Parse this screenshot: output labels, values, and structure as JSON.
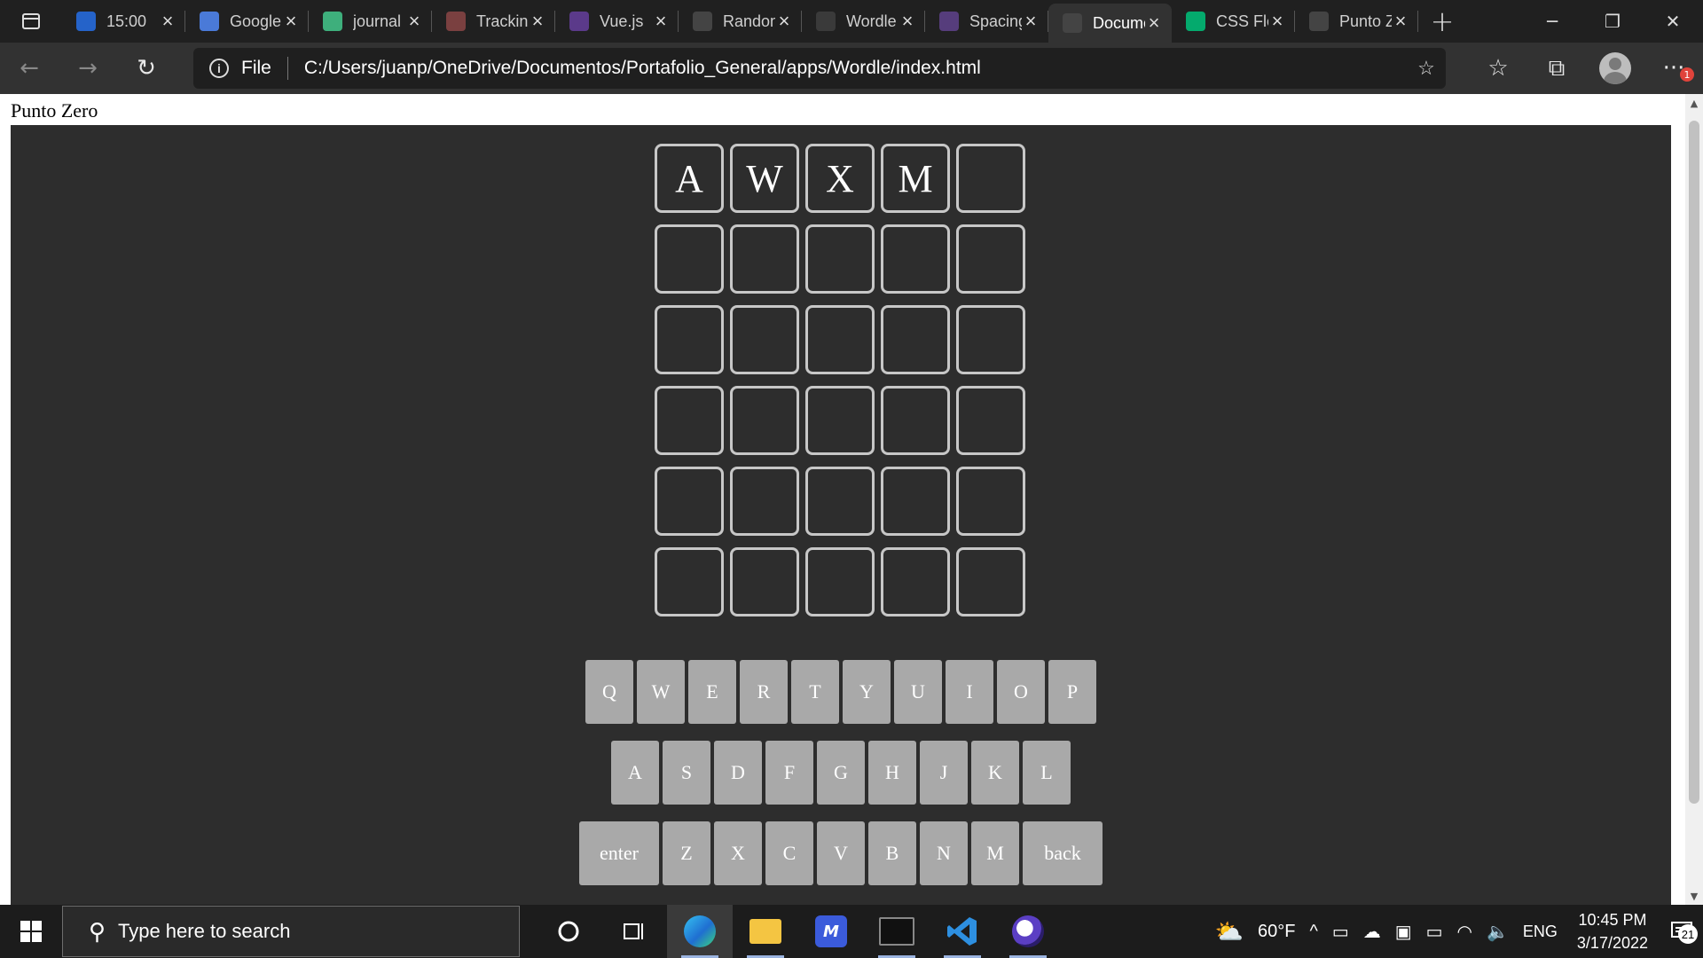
{
  "browser": {
    "tabs": [
      {
        "title": "15:00",
        "favicon": "todo-icon",
        "color": "#2563c9"
      },
      {
        "title": "Google Translate",
        "favicon": "translate-icon",
        "color": "#4a7ad8"
      },
      {
        "title": "journal",
        "favicon": "vue-icon",
        "color": "#3eaf7c"
      },
      {
        "title": "Tracking",
        "favicon": "pdf-icon",
        "color": "#7a4040"
      },
      {
        "title": "Vue.js",
        "favicon": "vuetify-icon",
        "color": "#5b3a8a"
      },
      {
        "title": "Random",
        "favicon": "page-icon",
        "color": "#444444"
      },
      {
        "title": "Wordle",
        "favicon": "grid-icon",
        "color": "#3a3a3a"
      },
      {
        "title": "Spacing",
        "favicon": "bootstrap-icon",
        "color": "#563d7c"
      },
      {
        "title": "Document",
        "favicon": "page-icon",
        "color": "#444444",
        "active": true
      },
      {
        "title": "CSS Flexbox",
        "favicon": "w3-icon",
        "color": "#04aa6d"
      },
      {
        "title": "Punto Zero",
        "favicon": "page-icon",
        "color": "#444444"
      }
    ],
    "address": {
      "scheme_label": "File",
      "url": "C:/Users/juanp/OneDrive/Documentos/Portafolio_General/apps/Wordle/index.html"
    },
    "badge_count": "1"
  },
  "page": {
    "heading": "Punto Zero",
    "board": [
      [
        "A",
        "W",
        "X",
        "M",
        ""
      ],
      [
        "",
        "",
        "",
        "",
        ""
      ],
      [
        "",
        "",
        "",
        "",
        ""
      ],
      [
        "",
        "",
        "",
        "",
        ""
      ],
      [
        "",
        "",
        "",
        "",
        ""
      ],
      [
        "",
        "",
        "",
        "",
        ""
      ]
    ],
    "keyboard": {
      "row1": [
        "Q",
        "W",
        "E",
        "R",
        "T",
        "Y",
        "U",
        "I",
        "O",
        "P"
      ],
      "row2": [
        "A",
        "S",
        "D",
        "F",
        "G",
        "H",
        "J",
        "K",
        "L"
      ],
      "row3": [
        "enter",
        "Z",
        "X",
        "C",
        "V",
        "B",
        "N",
        "M",
        "back"
      ]
    }
  },
  "taskbar": {
    "search_placeholder": "Type here to search",
    "weather": "60°F",
    "language": "ENG",
    "time": "10:45 PM",
    "date": "3/17/2022",
    "notification_count": "21"
  }
}
